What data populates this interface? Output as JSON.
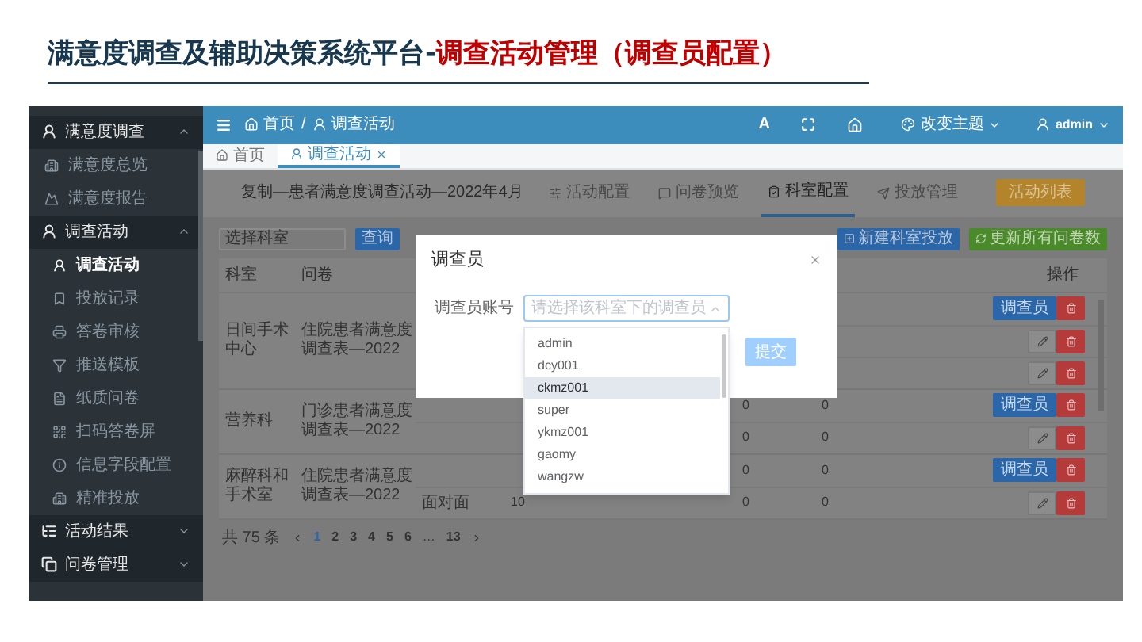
{
  "slide_title": {
    "main": "满意度调查及辅助决策系统平台-",
    "highlight": "调查活动管理（调查员配置）"
  },
  "sidebar": {
    "items": [
      {
        "label": "满意度调查",
        "expanded": true,
        "children": [
          {
            "label": "满意度总览",
            "selected": false
          },
          {
            "label": "满意度报告",
            "selected": false
          }
        ]
      },
      {
        "label": "调查活动",
        "expanded": true,
        "children": [
          {
            "label": "调查活动",
            "selected": true
          },
          {
            "label": "投放记录",
            "selected": false
          },
          {
            "label": "答卷审核",
            "selected": false
          },
          {
            "label": "推送模板",
            "selected": false
          },
          {
            "label": "纸质问卷",
            "selected": false
          },
          {
            "label": "扫码答卷屏",
            "selected": false
          },
          {
            "label": "信息字段配置",
            "selected": false
          },
          {
            "label": "精准投放",
            "selected": false
          }
        ]
      },
      {
        "label": "活动结果",
        "expanded": false
      },
      {
        "label": "问卷管理",
        "expanded": false
      }
    ]
  },
  "header": {
    "breadcrumb": [
      "首页",
      "调查活动"
    ],
    "breadcrumb_separator": "/",
    "font_button": "A",
    "theme_label": "改变主题",
    "user": "admin"
  },
  "page_tabs": [
    {
      "label": "首页",
      "selected": false,
      "closable": false
    },
    {
      "label": "调查活动",
      "selected": true,
      "closable": true
    }
  ],
  "activity": {
    "title": "复制—患者满意度调查活动—2022年4月",
    "tabs": [
      {
        "label": "活动配置",
        "selected": false
      },
      {
        "label": "问卷预览",
        "selected": false
      },
      {
        "label": "科室配置",
        "selected": true
      },
      {
        "label": "投放管理",
        "selected": false
      }
    ],
    "list_button": "活动列表"
  },
  "toolbar": {
    "search_placeholder": "选择科室",
    "search_button": "查询",
    "new_button": "新建科室投放",
    "refresh_button": "更新所有问卷数"
  },
  "table": {
    "columns": [
      "科室",
      "问卷",
      "操作"
    ],
    "rows": [
      {
        "department": "日间手术中心",
        "questionnaire": "住院患者满意度调查表—2022",
        "subrows": [
          {
            "kind": "assign",
            "action_label": "调查员"
          },
          {
            "kind": "edit"
          },
          {
            "kind": "edit"
          }
        ]
      },
      {
        "department": "营养科",
        "questionnaire": "门诊患者满意度调查表—2022",
        "subrows": [
          {
            "col5": "0",
            "col6": "0",
            "kind": "assign",
            "action_label": "调查员"
          },
          {
            "col5": "0",
            "col6": "0",
            "kind": "edit"
          }
        ]
      },
      {
        "department": "麻醉科和手术室",
        "questionnaire": "住院患者满意度调查表—2022",
        "subrows": [
          {
            "col5": "0",
            "col6": "0",
            "kind": "assign",
            "action_label": "调查员"
          },
          {
            "method": "面对面",
            "count": "10",
            "col5": "0",
            "col6": "0",
            "kind": "edit"
          }
        ]
      }
    ]
  },
  "pagination": {
    "total": "共 75 条",
    "pages": [
      {
        "label": "1",
        "selected": true
      },
      {
        "label": "2",
        "selected": false
      },
      {
        "label": "3",
        "selected": false
      },
      {
        "label": "4",
        "selected": false
      },
      {
        "label": "5",
        "selected": false
      },
      {
        "label": "6",
        "selected": false
      }
    ],
    "ellipsis": "…",
    "last": "13"
  },
  "modal": {
    "title": "调查员",
    "field_label": "调查员账号",
    "placeholder": "请选择该科室下的调查员",
    "submit": "提交",
    "options": [
      {
        "label": "admin",
        "highlighted": false
      },
      {
        "label": "dcy001",
        "highlighted": false
      },
      {
        "label": "ckmz001",
        "highlighted": true
      },
      {
        "label": "super",
        "highlighted": false
      },
      {
        "label": "ykmz001",
        "highlighted": false
      },
      {
        "label": "gaomy",
        "highlighted": false
      },
      {
        "label": "wangzw",
        "highlighted": false
      }
    ]
  }
}
